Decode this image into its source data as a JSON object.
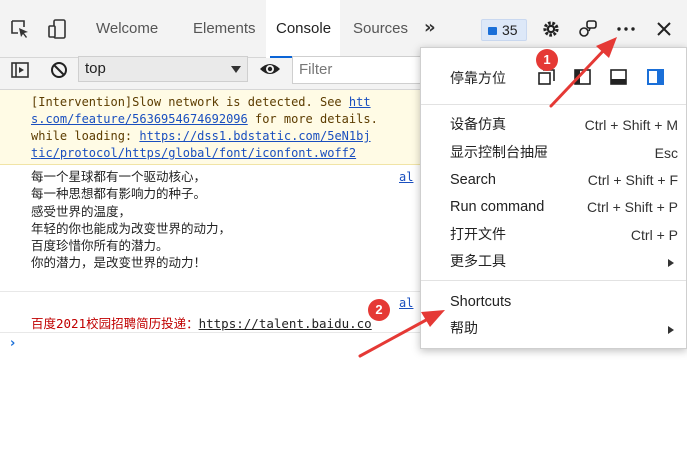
{
  "tabs": [
    {
      "label": "Welcome"
    },
    {
      "label": "Elements"
    },
    {
      "label": "Console"
    },
    {
      "label": "Sources"
    }
  ],
  "more_tabs_glyph": "»",
  "issues_count": "35",
  "toolbar": {
    "context": "top",
    "filter_placeholder": "Filter"
  },
  "console": {
    "warning_lines": [
      {
        "text": "[Intervention]Slow network is detected. See ",
        "link": "htt"
      },
      {
        "link": "s.com/feature/5636954674692096",
        "text": " for more details."
      },
      {
        "text": "while loading: ",
        "link": "https://dss1.bdstatic.com/5eN1bj"
      },
      {
        "link": "tic/protocol/https/global/font/iconfont.woff2",
        "text": ""
      }
    ],
    "log_message": "每一个星球都有一个驱动核心，\n每一种思想都有影响力的种子。\n感受世界的温度，\n年轻的你也能成为改变世界的动力，\n百度珍惜你所有的潜力。\n你的潜力，是改变世界的动力！",
    "source_1": "al",
    "source_2": "al",
    "recruit_text": "百度2021校园招聘简历投递：",
    "recruit_link": "https://talent.baidu.co",
    "prompt_glyph": "›"
  },
  "menu": {
    "dock_label": "停靠方位",
    "items": [
      {
        "label": "设备仿真",
        "shortcut": "Ctrl + Shift + M"
      },
      {
        "label": "显示控制台抽屉",
        "shortcut": "Esc"
      },
      {
        "label": "Search",
        "shortcut": "Ctrl + Shift + F"
      },
      {
        "label": "Run command",
        "shortcut": "Ctrl + Shift + P"
      },
      {
        "label": "打开文件",
        "shortcut": "Ctrl + P"
      },
      {
        "label": "更多工具",
        "shortcut": ""
      },
      {
        "label": "Shortcuts",
        "shortcut": ""
      },
      {
        "label": "帮助",
        "shortcut": ""
      }
    ]
  },
  "annotations": {
    "badge_1": "1",
    "badge_2": "2",
    "color": "#e53935"
  },
  "colors": {
    "accent": "#0a64d6",
    "warning_bg": "#fffbe5",
    "error_text": "#c00000"
  },
  "icons": {
    "inspect": "inspect-element-icon",
    "device": "device-toolbar-icon",
    "settings": "gear-icon",
    "connect": "connect-devices-icon",
    "more": "more-options-icon",
    "close": "close-icon",
    "sidebar": "show-sidebar-icon",
    "clear": "clear-console-icon",
    "eye": "live-expression-eye-icon"
  }
}
